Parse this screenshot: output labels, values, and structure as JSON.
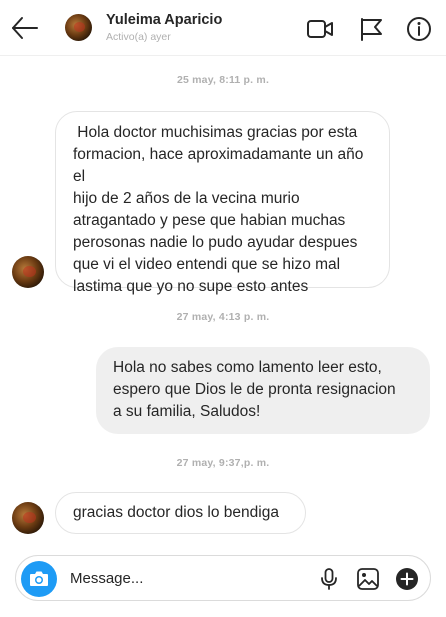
{
  "header": {
    "name": "Yuleima Aparicio",
    "status": "Activo(a) ayer",
    "icons": [
      "back-arrow-icon",
      "video-camera-icon",
      "flag-icon",
      "info-icon"
    ]
  },
  "conversation": {
    "timestamps": [
      "25 may, 8:11 p. m.",
      "27 may, 4:13 p. m.",
      "27 may, 9:37,p. m."
    ],
    "messages": [
      {
        "direction": "incoming",
        "lines": [
          " Hola doctor muchisimas gracias por esta",
          "formacion, hace aproximadamante un año el",
          "hijo de 2 años de la vecina murio",
          "atragantado y pese que habian muchas",
          "perosonas nadie lo pudo ayudar despues",
          "que vi el video entendi que se hizo mal",
          "lastima que yo no supe esto antes"
        ]
      },
      {
        "direction": "outgoing",
        "lines": [
          "Hola no sabes como lamento leer esto,",
          "espero que Dios le de pronta resignacion",
          "a su familia, Saludos!"
        ]
      },
      {
        "direction": "incoming",
        "lines": [
          "gracias doctor dios lo bendiga"
        ]
      }
    ]
  },
  "composer": {
    "placeholder": "Message...",
    "icons": [
      "camera-icon",
      "microphone-icon",
      "image-icon",
      "add-icon"
    ]
  },
  "colors": {
    "accent": "#1e9bf5",
    "outgoing_bubble": "#efefef",
    "incoming_border": "#e4e4e4",
    "muted_text": "#b0b0b0"
  }
}
